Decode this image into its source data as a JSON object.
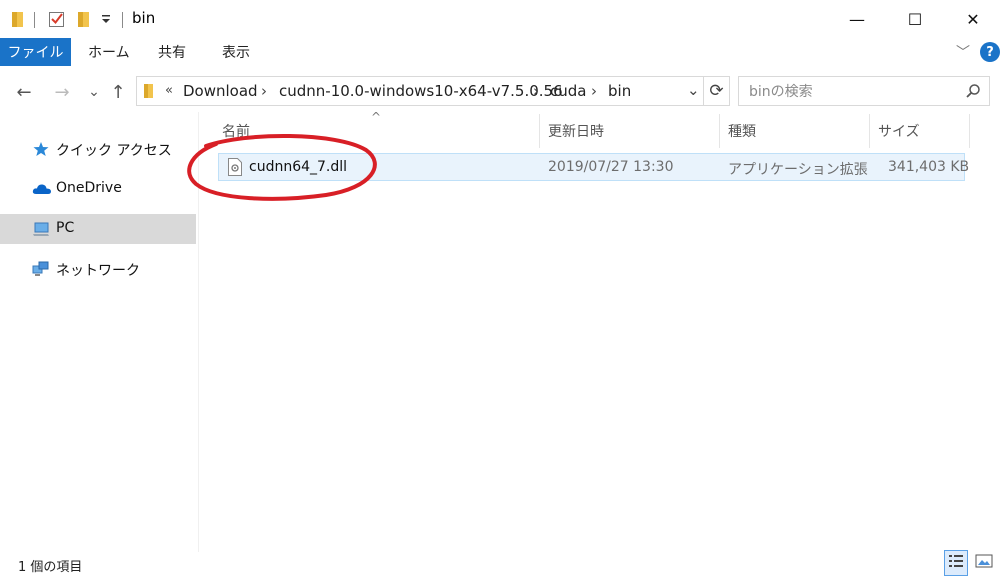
{
  "window": {
    "title": "bin",
    "minimize_glyph": "—",
    "maximize_glyph": "☐",
    "close_glyph": "✕"
  },
  "ribbon": {
    "tabs": [
      {
        "label": "ファイル",
        "active": true
      },
      {
        "label": "ホーム"
      },
      {
        "label": "共有"
      },
      {
        "label": "表示"
      }
    ],
    "expand_glyph": "﹀",
    "help_glyph": "?"
  },
  "nav": {
    "back_glyph": "←",
    "forward_glyph": "→",
    "recent_glyph": "⌄",
    "up_glyph": "↑"
  },
  "address": {
    "overflow_glyph": "«",
    "segments": [
      "Download",
      "cudnn-10.0-windows10-x64-v7.5.0.56",
      "cuda",
      "bin"
    ],
    "separator_glyph": "›",
    "dropdown_glyph": "⌄",
    "refresh_glyph": "⟳"
  },
  "search": {
    "placeholder": "binの検索"
  },
  "sidebar": {
    "items": [
      {
        "label": "クイック アクセス",
        "icon": "star-icon"
      },
      {
        "label": "OneDrive",
        "icon": "cloud-icon"
      },
      {
        "label": "PC",
        "icon": "computer-icon",
        "selected": true
      },
      {
        "label": "ネットワーク",
        "icon": "network-icon"
      }
    ]
  },
  "columns": {
    "name": "名前",
    "date": "更新日時",
    "type": "種類",
    "size": "サイズ",
    "sort_glyph": "^"
  },
  "files": [
    {
      "name": "cudnn64_7.dll",
      "date": "2019/07/27 13:30",
      "type": "アプリケーション拡張",
      "size": "341,403 KB",
      "icon": "dll-file-icon"
    }
  ],
  "status": {
    "item_count": "1 個の項目"
  },
  "colors": {
    "accent": "#1a73c8",
    "highlight_annotation": "#d81f26",
    "selected_row": "#e9f3fc"
  }
}
